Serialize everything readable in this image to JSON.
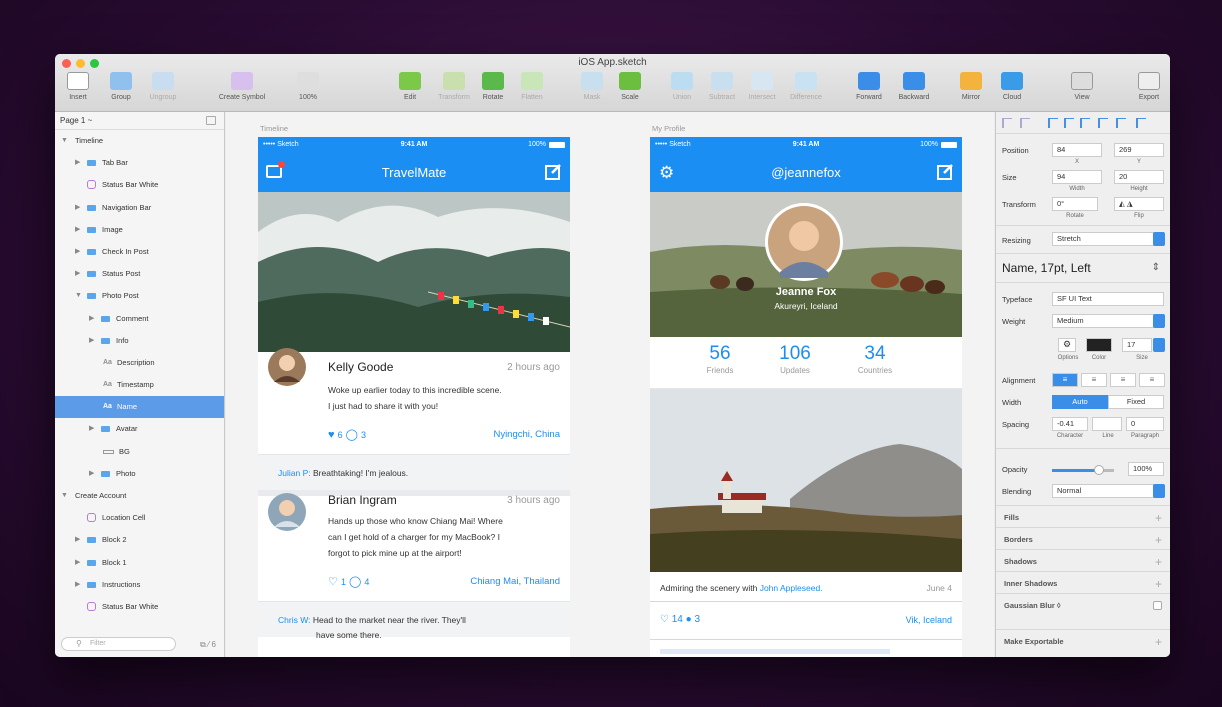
{
  "window": {
    "title": "iOS App.sketch"
  },
  "toolbar": [
    {
      "label": "Insert",
      "dis": false
    },
    {
      "label": "Group",
      "dis": false
    },
    {
      "label": "Ungroup",
      "dis": true
    },
    {
      "label": "Create Symbol",
      "dis": false
    },
    {
      "label": "100%",
      "dis": false
    },
    {
      "label": "Edit",
      "dis": false
    },
    {
      "label": "Transform",
      "dis": true
    },
    {
      "label": "Rotate",
      "dis": false
    },
    {
      "label": "Flatten",
      "dis": true
    },
    {
      "label": "Mask",
      "dis": true
    },
    {
      "label": "Scale",
      "dis": false
    },
    {
      "label": "Union",
      "dis": true
    },
    {
      "label": "Subtract",
      "dis": true
    },
    {
      "label": "Intersect",
      "dis": true
    },
    {
      "label": "Difference",
      "dis": true
    },
    {
      "label": "Forward",
      "dis": false
    },
    {
      "label": "Backward",
      "dis": false
    },
    {
      "label": "Mirror",
      "dis": false
    },
    {
      "label": "Cloud",
      "dis": false
    },
    {
      "label": "View",
      "dis": false
    },
    {
      "label": "Export",
      "dis": false
    }
  ],
  "colors": {
    "accent": "#1b8ef4",
    "selection": "#5b9be8"
  },
  "layers": {
    "page": "Page 1 ~",
    "filter_placeholder": "Filter",
    "rows": [
      {
        "label": "Timeline",
        "type": "group",
        "depth": 0
      },
      {
        "label": "Tab Bar",
        "type": "folder",
        "depth": 1
      },
      {
        "label": "Status Bar White",
        "type": "symbol",
        "depth": 1
      },
      {
        "label": "Navigation Bar",
        "type": "folder",
        "depth": 1
      },
      {
        "label": "Image",
        "type": "folder",
        "depth": 1
      },
      {
        "label": "Check In Post",
        "type": "folder",
        "depth": 1
      },
      {
        "label": "Status Post",
        "type": "folder",
        "depth": 1
      },
      {
        "label": "Photo Post",
        "type": "folder",
        "depth": 1,
        "open": true
      },
      {
        "label": "Comment",
        "type": "folder",
        "depth": 2
      },
      {
        "label": "Info",
        "type": "folder",
        "depth": 2
      },
      {
        "label": "Description",
        "type": "text",
        "depth": 3
      },
      {
        "label": "Timestamp",
        "type": "text",
        "depth": 3
      },
      {
        "label": "Name",
        "type": "text",
        "depth": 3,
        "selected": true
      },
      {
        "label": "Avatar",
        "type": "folder",
        "depth": 2
      },
      {
        "label": "BG",
        "type": "rect",
        "depth": 3
      },
      {
        "label": "Photo",
        "type": "folder",
        "depth": 2
      },
      {
        "label": "Create Account",
        "type": "group",
        "depth": 0
      },
      {
        "label": "Location Cell",
        "type": "symbol",
        "depth": 1
      },
      {
        "label": "Block 2",
        "type": "folder",
        "depth": 1
      },
      {
        "label": "Block 1",
        "type": "folder",
        "depth": 1
      },
      {
        "label": "Instructions",
        "type": "folder",
        "depth": 1
      },
      {
        "label": "Status Bar White",
        "type": "symbol",
        "depth": 1
      }
    ]
  },
  "timeline": {
    "artboard_label": "Timeline",
    "carrier": "••••• Sketch",
    "time": "9:41 AM",
    "battery": "100%",
    "title": "TravelMate",
    "posts": [
      {
        "name": "Kelly Goode",
        "time": "2 hours ago",
        "text1": "Woke up earlier today to this incredible scene.",
        "text2": "I just had to share it with you!",
        "likes": "6",
        "comments": "3",
        "location": "Nyingchi, China",
        "commenter": "Julian P:",
        "comment": "Breathtaking! I'm jealous."
      },
      {
        "name": "Brian Ingram",
        "time": "3 hours ago",
        "text1": "Hands up those who know Chiang Mai! Where",
        "text2": "can I get hold of a charger for my MacBook? I",
        "text3": "forgot to pick mine up at the airport!",
        "likes": "1",
        "comments": "4",
        "location": "Chiang Mai, Thailand",
        "commenter": "Chris W:",
        "comment": "Head to the market near the river. They'll",
        "comment2": "have some there."
      }
    ]
  },
  "profile": {
    "artboard_label": "My Profile",
    "carrier": "••••• Sketch",
    "time": "9:41 AM",
    "battery": "100%",
    "title": "@jeannefox",
    "name": "Jeanne Fox",
    "place": "Akureyri, Iceland",
    "stats": [
      {
        "value": "56",
        "label": "Friends"
      },
      {
        "value": "106",
        "label": "Updates"
      },
      {
        "value": "34",
        "label": "Countries"
      }
    ],
    "caption_pre": "Admiring the scenery with ",
    "caption_link": "John Appleseed.",
    "date": "June 4",
    "likes": "14",
    "comments": "3",
    "location": "Vik, Iceland"
  },
  "inspector": {
    "position_label": "Position",
    "x": "84",
    "y": "269",
    "x_label": "X",
    "y_label": "Y",
    "size_label": "Size",
    "w": "94",
    "h": "20",
    "w_label": "Width",
    "h_label": "Height",
    "transform_label": "Transform",
    "rotate": "0°",
    "rotate_label": "Rotate",
    "flip_label": "Flip",
    "resizing_label": "Resizing",
    "resizing": "Stretch",
    "text_style": "Name, 17pt, Left",
    "typeface_label": "Typeface",
    "typeface": "SF UI Text",
    "weight_label": "Weight",
    "weight": "Medium",
    "options_label": "Options",
    "color_label": "Color",
    "size_sub": "Size",
    "font_size": "17",
    "alignment_label": "Alignment",
    "width_label": "Width",
    "auto": "Auto",
    "fixed": "Fixed",
    "spacing_label": "Spacing",
    "char": "-0.41",
    "para": "0",
    "char_label": "Character",
    "line_label": "Line",
    "para_label": "Paragraph",
    "opacity_label": "Opacity",
    "opacity": "100%",
    "opacity_level": 0.75,
    "blending_label": "Blending",
    "blending": "Normal",
    "sections": [
      "Fills",
      "Borders",
      "Shadows",
      "Inner Shadows",
      "Gaussian Blur ◊",
      "Make Exportable"
    ]
  }
}
